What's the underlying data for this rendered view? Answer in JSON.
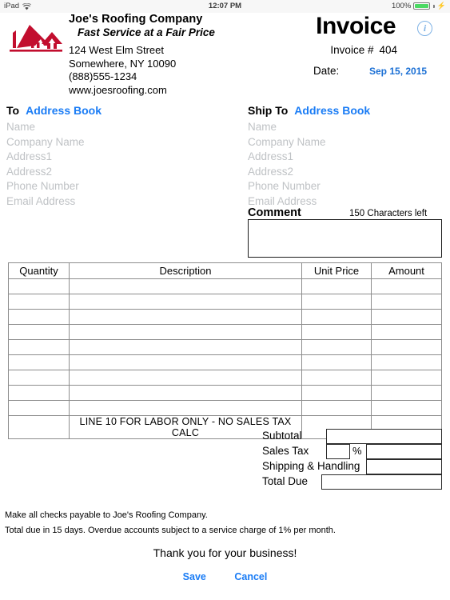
{
  "status_bar": {
    "device": "iPad",
    "wifi_icon": "wifi-icon",
    "time": "12:07 PM",
    "battery_percent": "100%",
    "battery_color": "#4cd964",
    "charging_icon": "lightning-bolt-icon"
  },
  "header": {
    "logo_icon": "red-roof-house-logo",
    "company_name": "Joe's Roofing Company",
    "tagline": "Fast Service at a Fair Price",
    "address_line1": "124 West Elm Street",
    "address_line2": "Somewhere, NY 10090",
    "phone": "(888)555-1234",
    "website": "www.joesroofing.com",
    "title": "Invoice",
    "info_icon": "info-circle-icon",
    "info_glyph": "i",
    "invoice_number_label": "Invoice #",
    "invoice_number_value": "404",
    "date_label": "Date:",
    "date_value": "Sep 15, 2015",
    "link_color": "#1a7cf5"
  },
  "bill_to": {
    "heading": "To",
    "address_book_link": "Address Book",
    "fields": [
      "Name",
      "Company Name",
      "Address1",
      "Address2",
      "Phone Number",
      "Email Address"
    ]
  },
  "ship_to": {
    "heading": "Ship To",
    "address_book_link": "Address Book",
    "fields": [
      "Name",
      "Company Name",
      "Address1",
      "Address2",
      "Phone Number",
      "Email Address"
    ]
  },
  "comment": {
    "label": "Comment",
    "characters_left": "150",
    "characters_left_suffix": "Characters left",
    "value": ""
  },
  "line_items": {
    "columns": [
      "Quantity",
      "Description",
      "Unit Price",
      "Amount"
    ],
    "rows": [
      {
        "quantity": "",
        "description": "",
        "unit_price": "",
        "amount": ""
      },
      {
        "quantity": "",
        "description": "",
        "unit_price": "",
        "amount": ""
      },
      {
        "quantity": "",
        "description": "",
        "unit_price": "",
        "amount": ""
      },
      {
        "quantity": "",
        "description": "",
        "unit_price": "",
        "amount": ""
      },
      {
        "quantity": "",
        "description": "",
        "unit_price": "",
        "amount": ""
      },
      {
        "quantity": "",
        "description": "",
        "unit_price": "",
        "amount": ""
      },
      {
        "quantity": "",
        "description": "",
        "unit_price": "",
        "amount": ""
      },
      {
        "quantity": "",
        "description": "",
        "unit_price": "",
        "amount": ""
      },
      {
        "quantity": "",
        "description": "",
        "unit_price": "",
        "amount": ""
      },
      {
        "quantity": "",
        "description": "",
        "unit_price": "",
        "amount": ""
      }
    ],
    "labor_note": "LINE 10 FOR LABOR ONLY - NO SALES TAX CALC"
  },
  "totals": {
    "subtotal_label": "Subtotal",
    "subtotal_value": "",
    "sales_tax_label": "Sales Tax",
    "sales_tax_percent": "",
    "percent_sign": "%",
    "sales_tax_value": "",
    "shipping_label": "Shipping & Handling",
    "shipping_value": "",
    "total_due_label": "Total Due",
    "total_due_value": ""
  },
  "footer": {
    "line1": "Make all checks payable to Joe's Roofing Company.",
    "line2": "Total due in 15 days. Overdue accounts subject to a service charge of 1% per month.",
    "thanks": "Thank you for your business!",
    "save_label": "Save",
    "cancel_label": "Cancel"
  }
}
